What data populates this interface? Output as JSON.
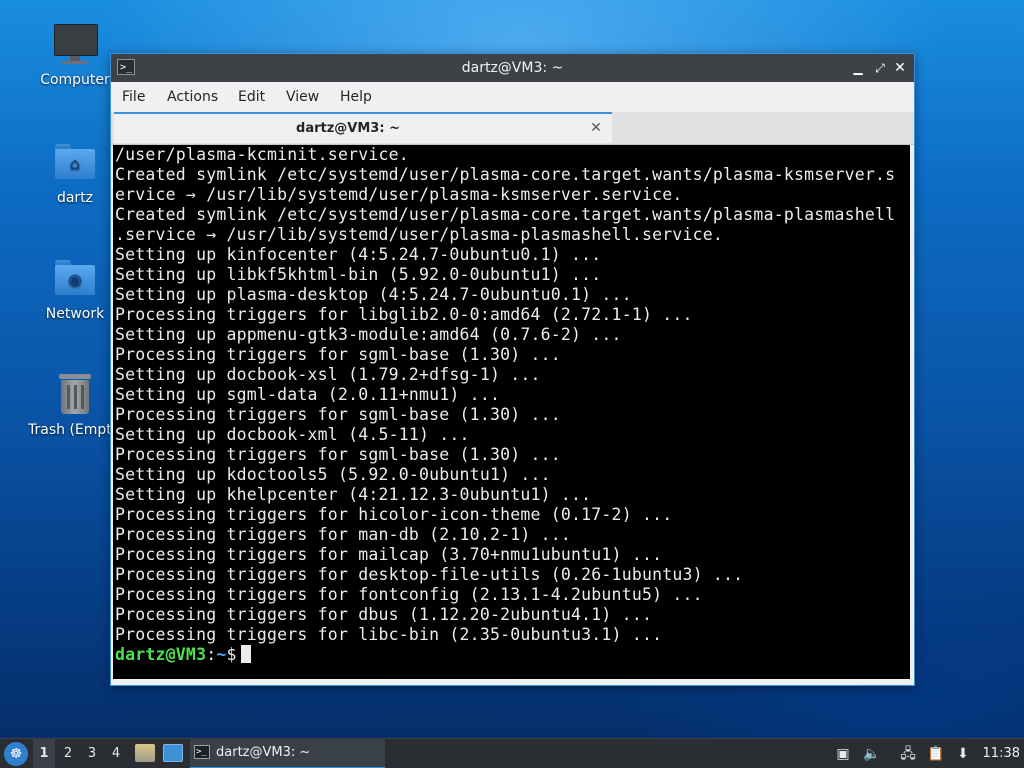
{
  "desktop": {
    "icons": [
      {
        "label": "Computer",
        "icon": "computer-icon"
      },
      {
        "label": "dartz",
        "icon": "home-folder-icon"
      },
      {
        "label": "Network",
        "icon": "network-folder-icon"
      },
      {
        "label": "Trash (Empty)",
        "icon": "trash-icon"
      }
    ]
  },
  "window": {
    "title": "dartz@VM3: ~",
    "menu": [
      "File",
      "Actions",
      "Edit",
      "View",
      "Help"
    ],
    "tab": {
      "label": "dartz@VM3: ~"
    }
  },
  "terminal": {
    "lines": [
      "/user/plasma-kcminit.service.",
      "Created symlink /etc/systemd/user/plasma-core.target.wants/plasma-ksmserver.s",
      "ervice → /usr/lib/systemd/user/plasma-ksmserver.service.",
      "Created symlink /etc/systemd/user/plasma-core.target.wants/plasma-plasmashell",
      ".service → /usr/lib/systemd/user/plasma-plasmashell.service.",
      "Setting up kinfocenter (4:5.24.7-0ubuntu0.1) ...",
      "Setting up libkf5khtml-bin (5.92.0-0ubuntu1) ...",
      "Setting up plasma-desktop (4:5.24.7-0ubuntu0.1) ...",
      "Processing triggers for libglib2.0-0:amd64 (2.72.1-1) ...",
      "Setting up appmenu-gtk3-module:amd64 (0.7.6-2) ...",
      "Processing triggers for sgml-base (1.30) ...",
      "Setting up docbook-xsl (1.79.2+dfsg-1) ...",
      "Setting up sgml-data (2.0.11+nmu1) ...",
      "Processing triggers for sgml-base (1.30) ...",
      "Setting up docbook-xml (4.5-11) ...",
      "Processing triggers for sgml-base (1.30) ...",
      "Setting up kdoctools5 (5.92.0-0ubuntu1) ...",
      "Setting up khelpcenter (4:21.12.3-0ubuntu1) ...",
      "Processing triggers for hicolor-icon-theme (0.17-2) ...",
      "Processing triggers for man-db (2.10.2-1) ...",
      "Processing triggers for mailcap (3.70+nmu1ubuntu1) ...",
      "Processing triggers for desktop-file-utils (0.26-1ubuntu3) ...",
      "Processing triggers for fontconfig (2.13.1-4.2ubuntu5) ...",
      "Processing triggers for dbus (1.12.20-2ubuntu4.1) ...",
      "Processing triggers for libc-bin (2.35-0ubuntu3.1) ..."
    ],
    "prompt": {
      "user_host": "dartz@VM3",
      "colon": ":",
      "path": "~",
      "symbol": "$"
    }
  },
  "taskbar": {
    "desktops": [
      "1",
      "2",
      "3",
      "4"
    ],
    "active_desktop": "1",
    "task": {
      "label": "dartz@VM3: ~"
    },
    "clock": "11:38"
  },
  "colors": {
    "accent": "#3d8fd6",
    "prompt_user": "#4ee04e",
    "prompt_path": "#5aa0ff"
  }
}
